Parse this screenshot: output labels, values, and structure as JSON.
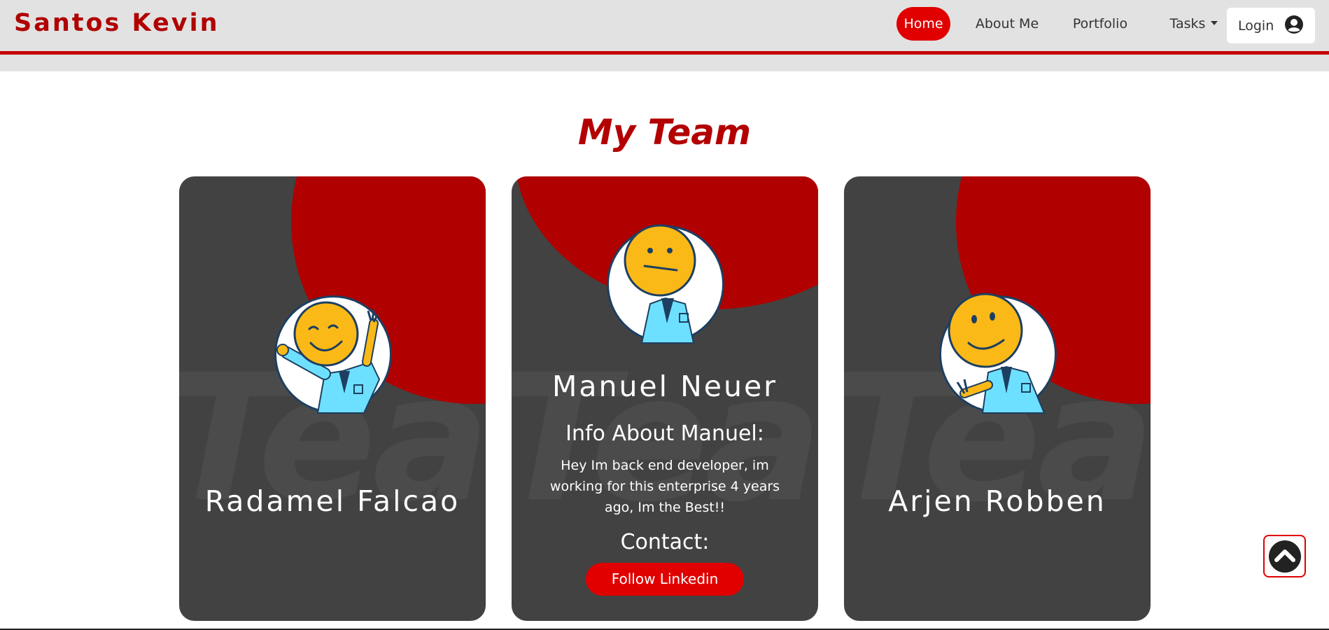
{
  "navbar": {
    "brand": "Santos Kevin",
    "links": [
      {
        "label": "Home",
        "active": true
      },
      {
        "label": "About Me",
        "active": false
      },
      {
        "label": "Portfolio",
        "active": false
      },
      {
        "label": "Tasks",
        "active": false,
        "dropdown": true
      }
    ],
    "login_label": "Login",
    "login_icon": "user-circle-icon"
  },
  "section": {
    "title": "My Team",
    "watermark": "Team"
  },
  "cards": [
    {
      "name": "Radamel Falcao",
      "avatar": "waving-smiley-avatar"
    },
    {
      "name": "Manuel Neuer",
      "avatar": "neutral-smiley-avatar",
      "info_title": "Info About Manuel:",
      "info_text": "Hey Im back end developer, im working for this enterprise 4 years ago, Im the Best!!",
      "contact_title": "Contact:",
      "button_label": "Follow Linkedin"
    },
    {
      "name": "Arjen Robben",
      "avatar": "pointing-smiley-avatar"
    }
  ],
  "scroll_top": {
    "icon": "chevron-up-circle-icon"
  },
  "colors": {
    "accent": "#e00000",
    "brand": "#b00000",
    "navbar_bg": "#e2e2e2",
    "card_bg": "#424242",
    "avatar_face": "#fbb917",
    "avatar_shirt": "#6ee0ff"
  }
}
